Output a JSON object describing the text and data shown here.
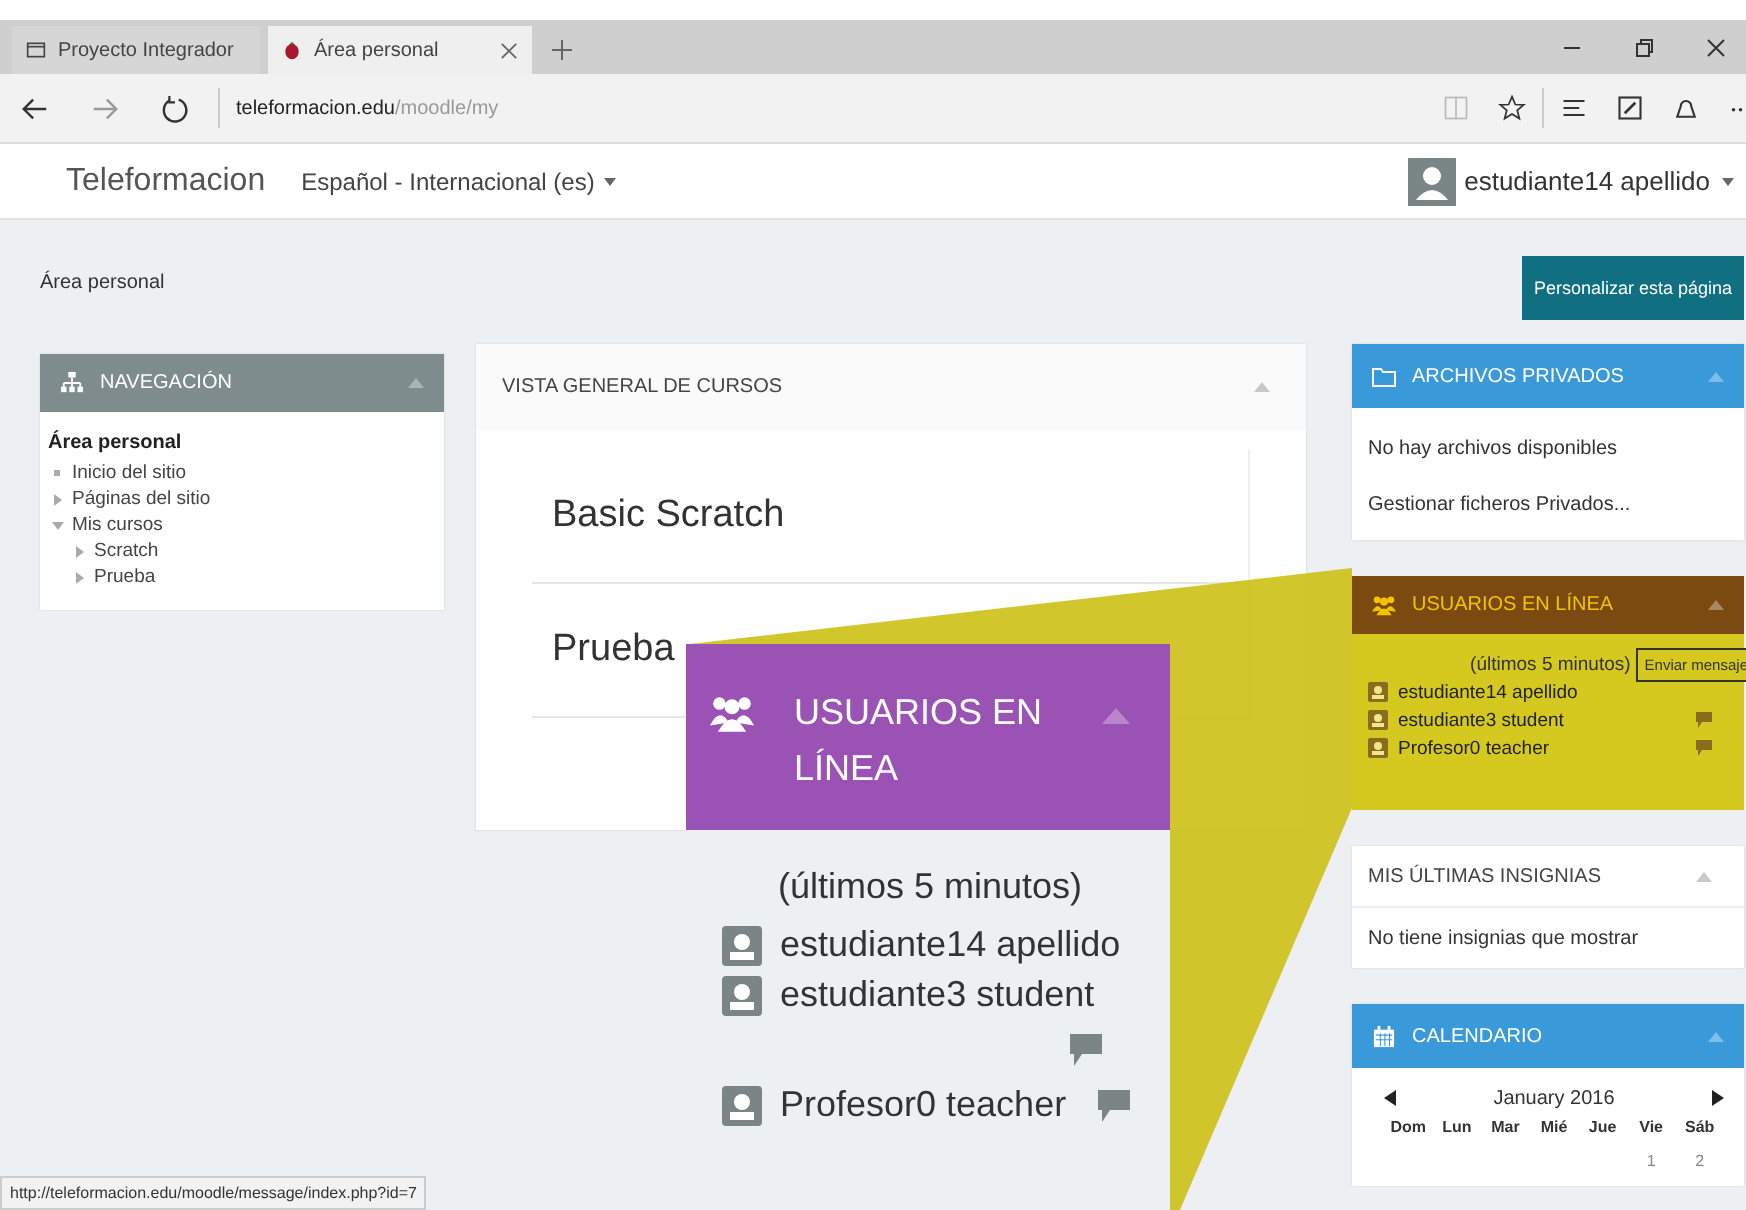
{
  "browser": {
    "tabs": [
      {
        "label": "Proyecto Integrador",
        "selected": false,
        "kind": "page"
      },
      {
        "label": "Área personal",
        "selected": true,
        "kind": "site"
      }
    ],
    "url": {
      "host": "teleformacion.edu",
      "path": "/moodle/my"
    }
  },
  "navbar": {
    "brand": "Teleformacion",
    "language": "Español - Internacional (es)",
    "user": "estudiante14 apellido"
  },
  "breadcrumb": "Área personal",
  "customize_button": "Personalizar esta página",
  "navigation": {
    "title": "NAVEGACIÓN",
    "root": "Área personal",
    "items": [
      {
        "label": "Inicio del sitio",
        "kind": "leaf"
      },
      {
        "label": "Páginas del sitio",
        "kind": "branch",
        "expanded": false
      },
      {
        "label": "Mis cursos",
        "kind": "branch",
        "expanded": true,
        "children": [
          {
            "label": "Scratch",
            "kind": "branch",
            "expanded": false
          },
          {
            "label": "Prueba",
            "kind": "branch",
            "expanded": false
          }
        ]
      }
    ]
  },
  "course_overview": {
    "title": "VISTA GENERAL DE CURSOS",
    "courses": [
      "Basic Scratch",
      "Prueba"
    ]
  },
  "private_files": {
    "title": "ARCHIVOS PRIVADOS",
    "empty_text": "No hay archivos disponibles",
    "link": "Gestionar ficheros Privados..."
  },
  "online_users": {
    "title": "USUARIOS EN LÍNEA",
    "period": "(últimos 5 minutos)",
    "tooltip": "Enviar mensaje",
    "users": [
      {
        "name": "estudiante14 apellido",
        "message_icon": false
      },
      {
        "name": "estudiante3 student",
        "message_icon": true
      },
      {
        "name": "Profesor0 teacher",
        "message_icon": true
      }
    ]
  },
  "badges": {
    "title": "MIS ÚLTIMAS INSIGNIAS",
    "empty_text": "No tiene insignias que mostrar"
  },
  "calendar": {
    "title": "CALENDARIO",
    "month": "January 2016",
    "weekdays": [
      "Dom",
      "Lun",
      "Mar",
      "Mié",
      "Jue",
      "Vie",
      "Sáb"
    ],
    "first_week": [
      "1",
      "2"
    ]
  },
  "callout": {
    "title": "USUARIOS EN LÍNEA",
    "period": "(últimos 5 minutos)",
    "users": [
      {
        "name": "estudiante14 apellido",
        "kind": "plain"
      },
      {
        "name": "estudiante3 student",
        "kind": "wrapped"
      },
      {
        "name": "Profesor0 teacher",
        "kind": "inline"
      }
    ]
  },
  "status_bar": "http://teleformacion.edu/moodle/message/index.php?id=7"
}
